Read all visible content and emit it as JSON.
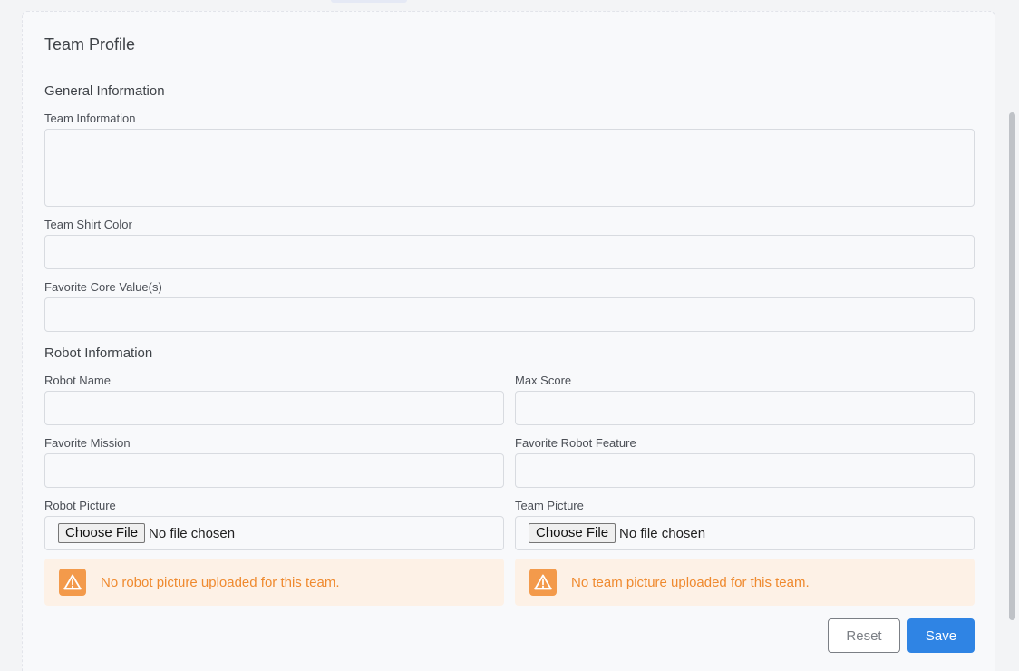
{
  "card": {
    "title": "Team Profile"
  },
  "general": {
    "heading": "General Information",
    "team_information": {
      "label": "Team Information",
      "value": ""
    },
    "team_shirt_color": {
      "label": "Team Shirt Color",
      "value": ""
    },
    "favorite_core_values": {
      "label": "Favorite Core Value(s)",
      "value": ""
    }
  },
  "robot": {
    "heading": "Robot Information",
    "robot_name": {
      "label": "Robot Name",
      "value": ""
    },
    "max_score": {
      "label": "Max Score",
      "value": ""
    },
    "favorite_mission": {
      "label": "Favorite Mission",
      "value": ""
    },
    "favorite_robot_feature": {
      "label": "Favorite Robot Feature",
      "value": ""
    },
    "robot_picture": {
      "label": "Robot Picture",
      "button_label": "Choose File",
      "status": "No file chosen",
      "warning": "No robot picture uploaded for this team."
    },
    "team_picture": {
      "label": "Team Picture",
      "button_label": "Choose File",
      "status": "No file chosen",
      "warning": "No team picture uploaded for this team."
    }
  },
  "actions": {
    "reset_label": "Reset",
    "save_label": "Save"
  },
  "icons": {
    "warning": "warning-triangle-icon"
  },
  "colors": {
    "primary": "#2f84e4",
    "warning_bg": "#fdf1e6",
    "warning_icon": "#f39a4b",
    "warning_text": "#ef8a2f"
  }
}
